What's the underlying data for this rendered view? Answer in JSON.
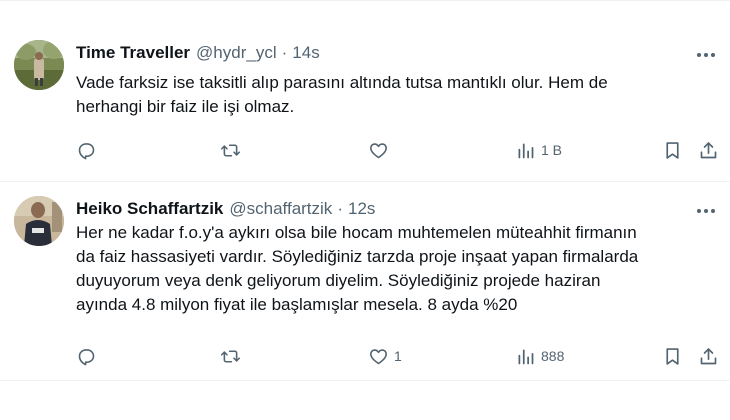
{
  "tweets": [
    {
      "name": "Time Traveller",
      "handle": "@hydr_ycl",
      "dot": "·",
      "time": "14s",
      "lines": [
        "Vade farksiz ise taksitli alıp parasını altında tutsa mantıklı olur. Hem de",
        "herhangi bir faiz ile işi olmaz."
      ],
      "replies": "",
      "retweets": "",
      "likes": "",
      "views": "1 B"
    },
    {
      "name": "Heiko Schaffartzik",
      "handle": "@schaffartzik",
      "dot": "·",
      "time": "12s",
      "lines": [
        "Her ne kadar f.o.y'a aykırı olsa bile hocam muhtemelen müteahhit firmanın",
        "da faiz hassasiyeti vardır. Söylediğiniz tarzda proje inşaat yapan firmalarda",
        "duyuyorum veya denk geliyorum diyelim. Söylediğiniz projede haziran",
        "ayında 4.8 milyon fiyat ile başlamışlar mesela. 8 ayda %20"
      ],
      "replies": "",
      "retweets": "",
      "likes": "1",
      "views": "888"
    }
  ],
  "icons": {
    "reply": "reply-icon",
    "retweet": "retweet-icon",
    "like": "heart-icon",
    "views": "views-icon",
    "bookmark": "bookmark-icon",
    "share": "share-icon",
    "more": "more-icon"
  },
  "colors": {
    "text": "#0f1419",
    "secondary": "#536471",
    "divider": "#eff3f4"
  }
}
